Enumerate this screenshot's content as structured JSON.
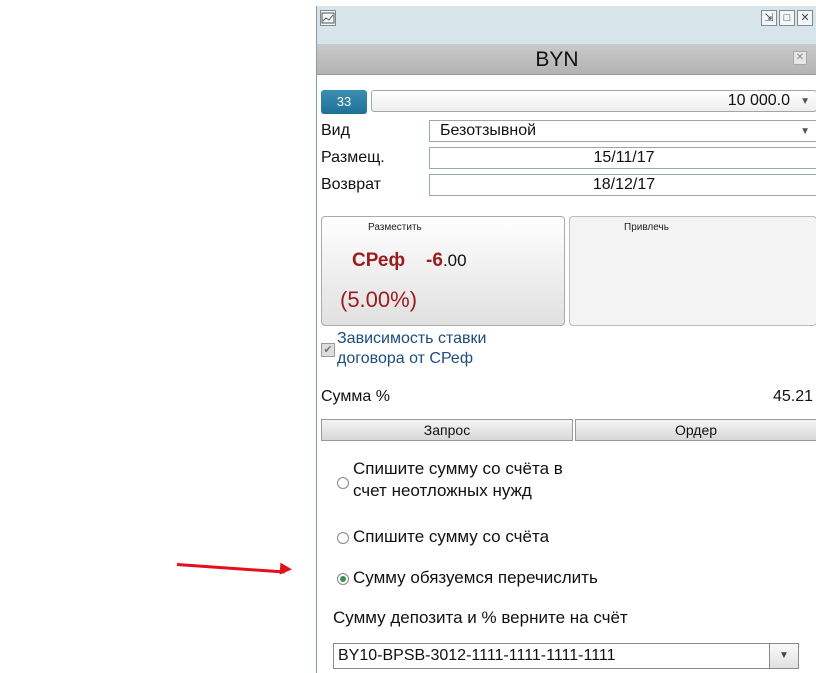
{
  "currency": "BYN",
  "chip": "33",
  "amount": "10 000.0",
  "fields": {
    "type_label": "Вид",
    "type_value": "Безотзывной",
    "place_label": "Размещ.",
    "place_value": "15/11/17",
    "return_label": "Возврат",
    "return_value": "18/12/17"
  },
  "panels": {
    "place_title": "Разместить",
    "attract_title": "Привлечь",
    "rate_name": "СРеф",
    "rate_spread_int": "-6",
    "rate_spread_dec": ".00",
    "rate_percent": "(5.00%)"
  },
  "checkbox_label_line1": "Зависимость ставки",
  "checkbox_label_line2": "договора от СРеф",
  "sum_label": "Сумма %",
  "sum_value": "45.21",
  "buttons": {
    "request": "Запрос",
    "order": "Ордер"
  },
  "radios": [
    {
      "line1": "Спишите сумму со счёта в",
      "line2": "счет неотложных нужд",
      "selected": false
    },
    {
      "line1": "Спишите сумму со счёта",
      "line2": "",
      "selected": false
    },
    {
      "line1": "Сумму обязуемся перечислить",
      "line2": "",
      "selected": true
    }
  ],
  "return_to_account_label": "Сумму депозита и % верните на счёт",
  "account": "BY10-BPSB-3012-1111-1111-1111-1111",
  "icons": [
    "chart-icon",
    "popout-icon",
    "maximize-icon",
    "close-icon",
    "dropdown-arrow-icon",
    "check-icon"
  ],
  "colors": {
    "accent": "#1f6f96",
    "rate": "#9b1d20",
    "arrow": "#e3101a",
    "radio_selected": "#3d8f55"
  }
}
